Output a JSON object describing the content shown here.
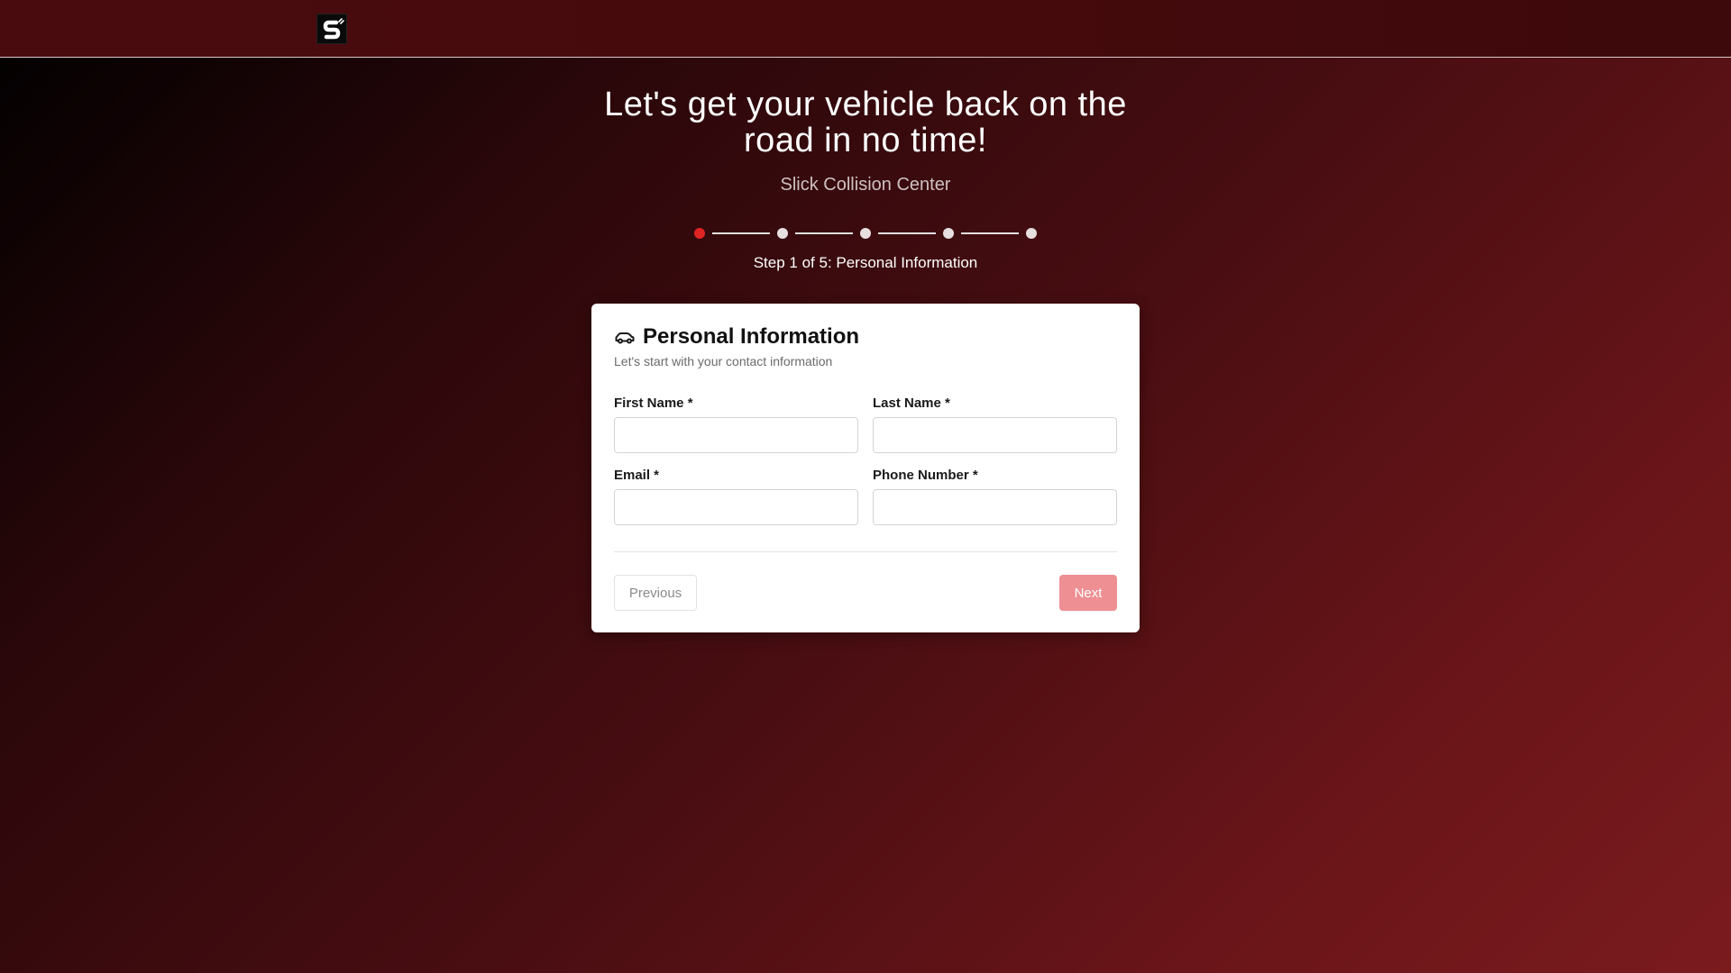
{
  "brand": {
    "logo_icon": "slick-s-logo-icon"
  },
  "hero": {
    "title": "Let's get your vehicle back on the road in no time!",
    "subtitle": "Slick Collision Center"
  },
  "stepper": {
    "current_step": 1,
    "total_steps": 5,
    "label": "Step 1 of 5: Personal Information",
    "active_color": "#e02424",
    "inactive_color": "#e6e0e0"
  },
  "card": {
    "icon": "car-icon",
    "title": "Personal Information",
    "description": "Let's start with your contact information",
    "fields": {
      "first_name": {
        "label": "First Name *",
        "value": "",
        "placeholder": ""
      },
      "last_name": {
        "label": "Last Name *",
        "value": "",
        "placeholder": ""
      },
      "email": {
        "label": "Email *",
        "value": "",
        "placeholder": ""
      },
      "phone": {
        "label": "Phone Number *",
        "value": "",
        "placeholder": ""
      }
    },
    "buttons": {
      "previous": "Previous",
      "next": "Next"
    }
  },
  "colors": {
    "accent": "#e02424",
    "next_button": "#ee8f93"
  }
}
